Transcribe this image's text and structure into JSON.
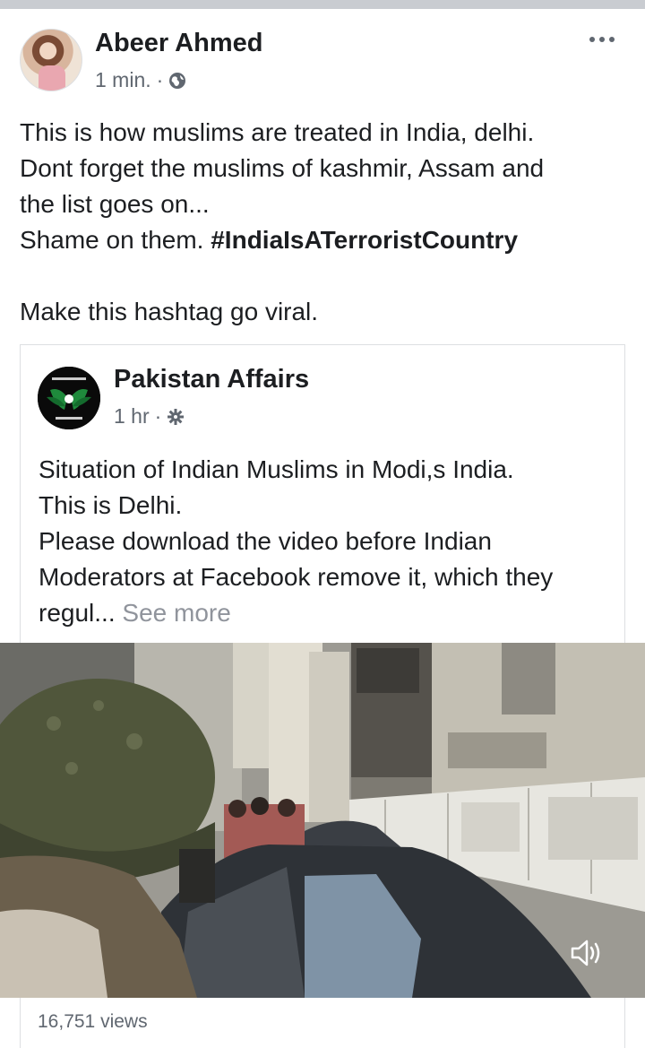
{
  "post": {
    "author": "Abeer Ahmed",
    "time": "1 min.",
    "separator": "·",
    "privacy_icon": "globe-icon",
    "text_lines": [
      "This is how muslims are treated in India, delhi.",
      "Dont forget the muslims of kashmir, Assam and",
      "the list goes on...",
      "Shame on them. "
    ],
    "hashtag": "#IndiaIsATerroristCountry",
    "closing_line": "Make this hashtag go viral.",
    "more_icon": "more-options-icon"
  },
  "shared": {
    "page_name": "Pakistan Affairs",
    "time": "1 hr",
    "separator": "·",
    "privacy_icon": "gear-icon",
    "text_lines": [
      "Situation of Indian Muslims in Modi,s India.",
      "This is Delhi.",
      "Please download the video before Indian",
      "Moderators at Facebook remove it, which they"
    ],
    "truncated_line": "regul... ",
    "see_more": "See more"
  },
  "video": {
    "sound_icon": "speaker-icon",
    "views": "16,751 views"
  },
  "colors": {
    "text": "#1c1e21",
    "meta": "#606770",
    "see_more": "#90949c",
    "border": "#dddfe2"
  }
}
